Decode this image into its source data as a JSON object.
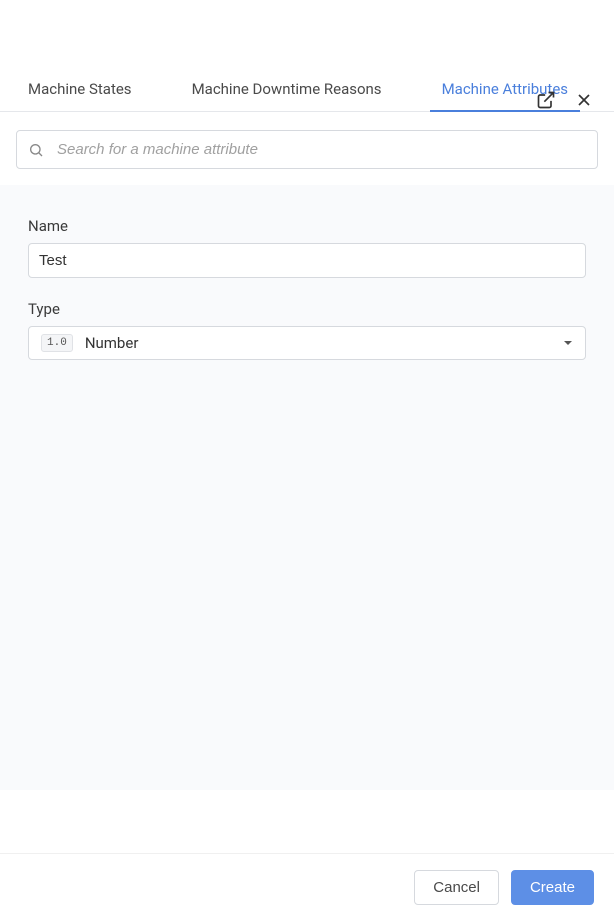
{
  "tabs": [
    {
      "label": "Machine States",
      "active": false
    },
    {
      "label": "Machine Downtime Reasons",
      "active": false
    },
    {
      "label": "Machine Attributes",
      "active": true
    }
  ],
  "search": {
    "placeholder": "Search for a machine attribute",
    "value": ""
  },
  "form": {
    "name": {
      "label": "Name",
      "value": "Test"
    },
    "type": {
      "label": "Type",
      "badge": "1.0",
      "value": "Number"
    }
  },
  "actions": {
    "cancel": "Cancel",
    "create": "Create"
  }
}
